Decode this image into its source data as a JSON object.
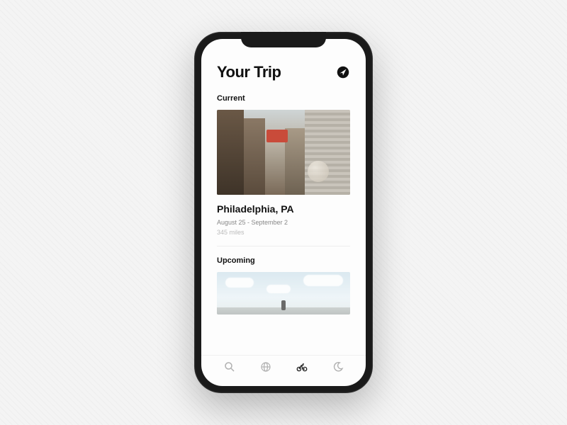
{
  "header": {
    "title": "Your Trip",
    "nav_icon": "navigation-arrow-icon"
  },
  "current": {
    "section_label": "Current",
    "destination": "Philadelphia, PA",
    "dates": "August 25 - September 2",
    "distance": "345 miles"
  },
  "upcoming": {
    "section_label": "Upcoming"
  },
  "tabs": [
    {
      "name": "search-icon",
      "active": false
    },
    {
      "name": "globe-icon",
      "active": false
    },
    {
      "name": "bicycle-icon",
      "active": true
    },
    {
      "name": "moon-icon",
      "active": false
    }
  ]
}
